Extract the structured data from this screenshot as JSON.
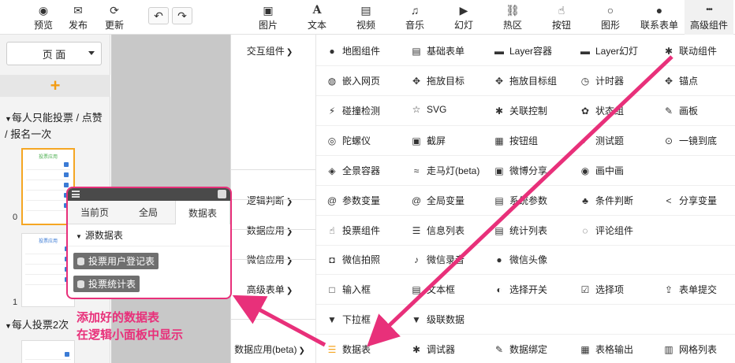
{
  "toolbar": {
    "left": [
      {
        "label": "预览",
        "icon": "eye-icon",
        "glyph": "◉"
      },
      {
        "label": "发布",
        "icon": "wechat-icon",
        "glyph": "✉"
      },
      {
        "label": "更新",
        "icon": "refresh-icon",
        "glyph": "⟳"
      }
    ],
    "undo_glyph": "↶",
    "redo_glyph": "↷",
    "right": [
      {
        "label": "图片",
        "icon": "image-icon",
        "glyph": "▣"
      },
      {
        "label": "文本",
        "icon": "text-icon",
        "glyph": "A"
      },
      {
        "label": "视频",
        "icon": "film-icon",
        "glyph": "▤"
      },
      {
        "label": "音乐",
        "icon": "music-icon",
        "glyph": "♫"
      },
      {
        "label": "幻灯",
        "icon": "play-icon",
        "glyph": "▶"
      },
      {
        "label": "热区",
        "icon": "link-icon",
        "glyph": "⛓"
      },
      {
        "label": "按钮",
        "icon": "pointer-icon",
        "glyph": "☝"
      },
      {
        "label": "图形",
        "icon": "circle-icon",
        "glyph": "○"
      },
      {
        "label": "联系表单",
        "icon": "user-icon",
        "glyph": "●"
      },
      {
        "label": "高级组件",
        "icon": "more-icon",
        "glyph": "•••"
      }
    ]
  },
  "sidebar": {
    "page_select": "页 面",
    "add_glyph": "+",
    "group1_title": "每人只能投票 / 点赞 / 报名一次",
    "group2_title": "每人投票2次",
    "thumb_title": "投票应用",
    "thumb_nums": [
      "0",
      "1"
    ]
  },
  "categories": [
    {
      "label": "交互组件"
    },
    {
      "label": "逻辑判断"
    },
    {
      "label": "数据应用"
    },
    {
      "label": "微信应用"
    },
    {
      "label": "高级表单"
    },
    {
      "label": "数据应用(beta)"
    }
  ],
  "menu_rows": [
    [
      {
        "label": "地图组件",
        "glyph": "●"
      },
      {
        "label": "基础表单",
        "glyph": "▤"
      },
      {
        "label": "Layer容器",
        "glyph": "▬"
      },
      {
        "label": "Layer幻灯",
        "glyph": "▬"
      },
      {
        "label": "联动组件",
        "glyph": "✱"
      }
    ],
    [
      {
        "label": "嵌入网页",
        "glyph": "◍"
      },
      {
        "label": "拖放目标",
        "glyph": "✥"
      },
      {
        "label": "拖放目标组",
        "glyph": "✥"
      },
      {
        "label": "计时器",
        "glyph": "◷"
      },
      {
        "label": "锚点",
        "glyph": "✥"
      }
    ],
    [
      {
        "label": "碰撞检测",
        "glyph": "⚡"
      },
      {
        "label": "SVG",
        "glyph": "☆"
      },
      {
        "label": "关联控制",
        "glyph": "✱"
      },
      {
        "label": "状态组",
        "glyph": "✿"
      },
      {
        "label": "画板",
        "glyph": "✎"
      }
    ],
    [
      {
        "label": "陀螺仪",
        "glyph": "◎"
      },
      {
        "label": "截屏",
        "glyph": "▣"
      },
      {
        "label": "按钮组",
        "glyph": "▦"
      },
      {
        "label": "测试题",
        "glyph": "✔"
      },
      {
        "label": "一镜到底",
        "glyph": "⊙"
      }
    ],
    [
      {
        "label": "全景容器",
        "glyph": "◈"
      },
      {
        "label": "走马灯(beta)",
        "glyph": "≈"
      },
      {
        "label": "微博分享",
        "glyph": "▣"
      },
      {
        "label": "画中画",
        "glyph": "◉"
      }
    ],
    [
      {
        "label": "参数变量",
        "glyph": "@"
      },
      {
        "label": "全局变量",
        "glyph": "@"
      },
      {
        "label": "系统参数",
        "glyph": "▤"
      },
      {
        "label": "条件判断",
        "glyph": "♣"
      },
      {
        "label": "分享变量",
        "glyph": "<"
      }
    ],
    [
      {
        "label": "投票组件",
        "glyph": "☝"
      },
      {
        "label": "信息列表",
        "glyph": "☰"
      },
      {
        "label": "统计列表",
        "glyph": "▤"
      },
      {
        "label": "评论组件",
        "glyph": "◌"
      }
    ],
    [
      {
        "label": "微信拍照",
        "glyph": "◘"
      },
      {
        "label": "微信录音",
        "glyph": "♪"
      },
      {
        "label": "微信头像",
        "glyph": "●"
      }
    ],
    [
      {
        "label": "输入框",
        "glyph": "□"
      },
      {
        "label": "文本框",
        "glyph": "▤"
      },
      {
        "label": "选择开关",
        "glyph": "◐"
      },
      {
        "label": "选择项",
        "glyph": "☑"
      },
      {
        "label": "表单提交",
        "glyph": "⇪"
      }
    ],
    [
      {
        "label": "下拉框",
        "glyph": "▼"
      },
      {
        "label": "级联数据",
        "glyph": "▼"
      }
    ],
    [
      {
        "label": "数据表",
        "glyph": "☰"
      },
      {
        "label": "调试器",
        "glyph": "✱"
      },
      {
        "label": "数据绑定",
        "glyph": "✎"
      },
      {
        "label": "表格输出",
        "glyph": "▦"
      },
      {
        "label": "网格列表",
        "glyph": "▥"
      }
    ]
  ],
  "data_panel": {
    "tabs": [
      "当前页",
      "全局",
      "数据表"
    ],
    "active_tab": 2,
    "source_title": "源数据表",
    "items": [
      "投票用户登记表",
      "投票统计表"
    ]
  },
  "callout": {
    "line1": "添加好的数据表",
    "line2": "在逻辑小面板中显示"
  },
  "colors": {
    "accent": "#e8307a",
    "orange": "#f5a623"
  }
}
